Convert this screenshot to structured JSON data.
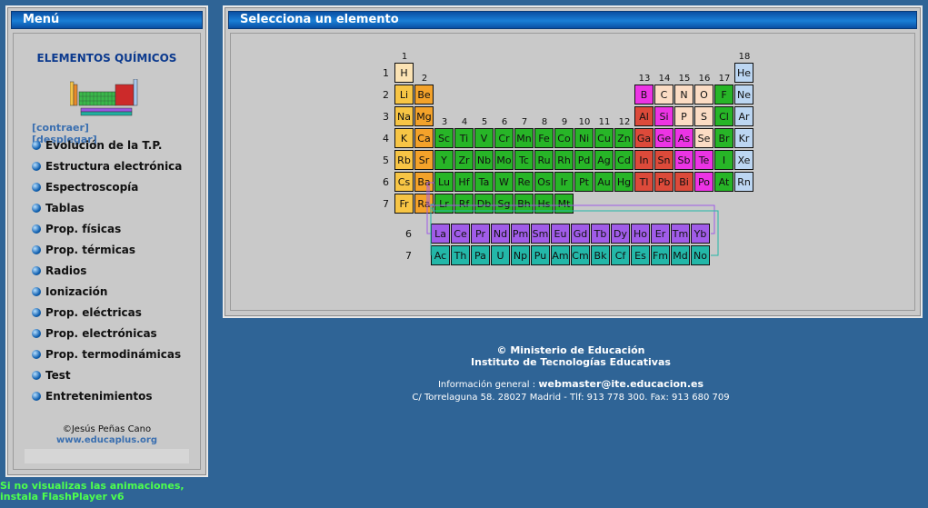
{
  "menu": {
    "title": "Menú",
    "heading": "ELEMENTOS QUÍMICOS",
    "collapse": "[contraer]",
    "expand": "[desplegar]",
    "items": [
      {
        "label": "Evolución de la T.P.",
        "name": "menu-item-evolucion"
      },
      {
        "label": "Estructura electrónica",
        "name": "menu-item-estructura"
      },
      {
        "label": "Espectroscopía",
        "name": "menu-item-espectroscopia"
      },
      {
        "label": "Tablas",
        "name": "menu-item-tablas"
      },
      {
        "label": "Prop. físicas",
        "name": "menu-item-prop-fisicas"
      },
      {
        "label": "Prop. térmicas",
        "name": "menu-item-prop-termicas"
      },
      {
        "label": "Radios",
        "name": "menu-item-radios"
      },
      {
        "label": "Ionización",
        "name": "menu-item-ionizacion"
      },
      {
        "label": "Prop. eléctricas",
        "name": "menu-item-prop-electricas"
      },
      {
        "label": "Prop. electrónicas",
        "name": "menu-item-prop-electronicas"
      },
      {
        "label": "Prop. termodinámicas",
        "name": "menu-item-prop-termodinamicas"
      },
      {
        "label": "Test",
        "name": "menu-item-test"
      },
      {
        "label": "Entretenimientos",
        "name": "menu-item-entretenimientos"
      }
    ],
    "author": "©Jesús Peñas Cano",
    "site": "www.educaplus.org"
  },
  "flash_notice": [
    "Si no visualizas las animaciones,",
    "instala FlashPlayer v6"
  ],
  "main": {
    "title": "Selecciona un elemento"
  },
  "footer": {
    "line1": "© Ministerio de Educación",
    "line2": "Instituto de Tecnologías Educativas",
    "info_prefix": "Información general :",
    "email": "webmaster@ite.educacion.es",
    "address": "C/ Torrelaguna 58. 28027 Madrid - Tlf: 913 778 300. Fax: 913 680 709"
  },
  "periodic_table": {
    "groups": [
      "1",
      "2",
      "3",
      "4",
      "5",
      "6",
      "7",
      "8",
      "9",
      "10",
      "11",
      "12",
      "13",
      "14",
      "15",
      "16",
      "17",
      "18"
    ],
    "periods": [
      "1",
      "2",
      "3",
      "4",
      "5",
      "6",
      "7"
    ],
    "lanthanide_period": "6",
    "actinide_period": "7",
    "colors": {
      "h": "#fbe3b4",
      "alk": "#f7c545",
      "alkearth": "#f3a22a",
      "tm": "#27b527",
      "post": "#dc4a3a",
      "met": "#ec34e4",
      "nonmet": "#fbdcc4",
      "halo": "#27b527",
      "noble": "#bcd6f2",
      "lan": "#a05ce8",
      "act": "#23b7a8"
    },
    "elements": [
      [
        "H",
        1,
        1,
        "h"
      ],
      [
        "He",
        1,
        18,
        "noble"
      ],
      [
        "Li",
        2,
        1,
        "alk"
      ],
      [
        "Be",
        2,
        2,
        "alkearth"
      ],
      [
        "B",
        2,
        13,
        "met"
      ],
      [
        "C",
        2,
        14,
        "nonmet"
      ],
      [
        "N",
        2,
        15,
        "nonmet"
      ],
      [
        "O",
        2,
        16,
        "nonmet"
      ],
      [
        "F",
        2,
        17,
        "halo"
      ],
      [
        "Ne",
        2,
        18,
        "noble"
      ],
      [
        "Na",
        3,
        1,
        "alk"
      ],
      [
        "Mg",
        3,
        2,
        "alkearth"
      ],
      [
        "Al",
        3,
        13,
        "post"
      ],
      [
        "Si",
        3,
        14,
        "met"
      ],
      [
        "P",
        3,
        15,
        "nonmet"
      ],
      [
        "S",
        3,
        16,
        "nonmet"
      ],
      [
        "Cl",
        3,
        17,
        "halo"
      ],
      [
        "Ar",
        3,
        18,
        "noble"
      ],
      [
        "K",
        4,
        1,
        "alk"
      ],
      [
        "Ca",
        4,
        2,
        "alkearth"
      ],
      [
        "Sc",
        4,
        3,
        "tm"
      ],
      [
        "Ti",
        4,
        4,
        "tm"
      ],
      [
        "V",
        4,
        5,
        "tm"
      ],
      [
        "Cr",
        4,
        6,
        "tm"
      ],
      [
        "Mn",
        4,
        7,
        "tm"
      ],
      [
        "Fe",
        4,
        8,
        "tm"
      ],
      [
        "Co",
        4,
        9,
        "tm"
      ],
      [
        "Ni",
        4,
        10,
        "tm"
      ],
      [
        "Cu",
        4,
        11,
        "tm"
      ],
      [
        "Zn",
        4,
        12,
        "tm"
      ],
      [
        "Ga",
        4,
        13,
        "post"
      ],
      [
        "Ge",
        4,
        14,
        "met"
      ],
      [
        "As",
        4,
        15,
        "met"
      ],
      [
        "Se",
        4,
        16,
        "nonmet"
      ],
      [
        "Br",
        4,
        17,
        "halo"
      ],
      [
        "Kr",
        4,
        18,
        "noble"
      ],
      [
        "Rb",
        5,
        1,
        "alk"
      ],
      [
        "Sr",
        5,
        2,
        "alkearth"
      ],
      [
        "Y",
        5,
        3,
        "tm"
      ],
      [
        "Zr",
        5,
        4,
        "tm"
      ],
      [
        "Nb",
        5,
        5,
        "tm"
      ],
      [
        "Mo",
        5,
        6,
        "tm"
      ],
      [
        "Tc",
        5,
        7,
        "tm"
      ],
      [
        "Ru",
        5,
        8,
        "tm"
      ],
      [
        "Rh",
        5,
        9,
        "tm"
      ],
      [
        "Pd",
        5,
        10,
        "tm"
      ],
      [
        "Ag",
        5,
        11,
        "tm"
      ],
      [
        "Cd",
        5,
        12,
        "tm"
      ],
      [
        "In",
        5,
        13,
        "post"
      ],
      [
        "Sn",
        5,
        14,
        "post"
      ],
      [
        "Sb",
        5,
        15,
        "met"
      ],
      [
        "Te",
        5,
        16,
        "met"
      ],
      [
        "I",
        5,
        17,
        "halo"
      ],
      [
        "Xe",
        5,
        18,
        "noble"
      ],
      [
        "Cs",
        6,
        1,
        "alk"
      ],
      [
        "Ba",
        6,
        2,
        "alkearth"
      ],
      [
        "Lu",
        6,
        3,
        "tm"
      ],
      [
        "Hf",
        6,
        4,
        "tm"
      ],
      [
        "Ta",
        6,
        5,
        "tm"
      ],
      [
        "W",
        6,
        6,
        "tm"
      ],
      [
        "Re",
        6,
        7,
        "tm"
      ],
      [
        "Os",
        6,
        8,
        "tm"
      ],
      [
        "Ir",
        6,
        9,
        "tm"
      ],
      [
        "Pt",
        6,
        10,
        "tm"
      ],
      [
        "Au",
        6,
        11,
        "tm"
      ],
      [
        "Hg",
        6,
        12,
        "tm"
      ],
      [
        "Tl",
        6,
        13,
        "post"
      ],
      [
        "Pb",
        6,
        14,
        "post"
      ],
      [
        "Bi",
        6,
        15,
        "post"
      ],
      [
        "Po",
        6,
        16,
        "met"
      ],
      [
        "At",
        6,
        17,
        "halo"
      ],
      [
        "Rn",
        6,
        18,
        "noble"
      ],
      [
        "Fr",
        7,
        1,
        "alk"
      ],
      [
        "Ra",
        7,
        2,
        "alkearth"
      ],
      [
        "Lr",
        7,
        3,
        "tm"
      ],
      [
        "Rf",
        7,
        4,
        "tm"
      ],
      [
        "Db",
        7,
        5,
        "tm"
      ],
      [
        "Sg",
        7,
        6,
        "tm"
      ],
      [
        "Bh",
        7,
        7,
        "tm"
      ],
      [
        "Hs",
        7,
        8,
        "tm"
      ],
      [
        "Mt",
        7,
        9,
        "tm"
      ]
    ],
    "lanthanides": [
      "La",
      "Ce",
      "Pr",
      "Nd",
      "Pm",
      "Sm",
      "Eu",
      "Gd",
      "Tb",
      "Dy",
      "Ho",
      "Er",
      "Tm",
      "Yb"
    ],
    "actinides": [
      "Ac",
      "Th",
      "Pa",
      "U",
      "Np",
      "Pu",
      "Am",
      "Cm",
      "Bk",
      "Cf",
      "Es",
      "Fm",
      "Md",
      "No"
    ]
  }
}
